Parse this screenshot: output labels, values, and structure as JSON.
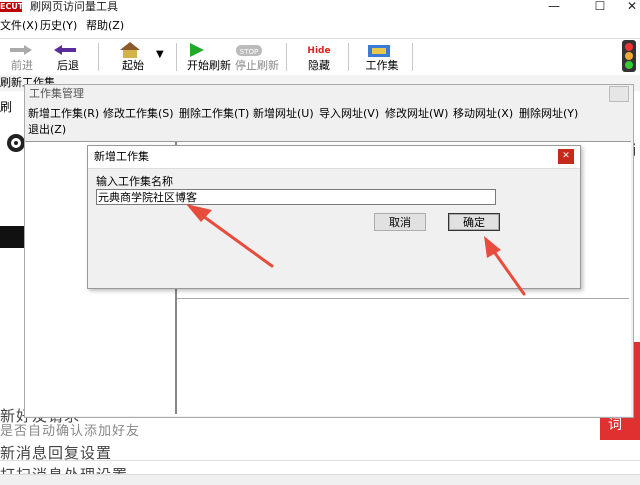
{
  "window": {
    "title": "刷网页访问量工具",
    "icon_text": "ECUT"
  },
  "menubar": [
    "文件(X)",
    "历史(Y)",
    "帮助(Z)"
  ],
  "toolbar": {
    "forward": "前进",
    "back": "后退",
    "start_page": "起始",
    "start_refresh": "开始刷新",
    "stop_refresh": "停止刷新",
    "hide": "隐藏",
    "workset": "工作集",
    "stop_icon_text": "STOP",
    "hide_icon_text": "Hide"
  },
  "background": {
    "toolbar_row_left": "刷新工作集",
    "toolbar_row_left2": "刷",
    "right_text": "销",
    "red_tab_text": "词",
    "rows": [
      "新好友请求",
      "是否自动确认添加好友",
      "新消息回复设置",
      "打扫消息处理设置"
    ]
  },
  "workset_manager": {
    "title": "工作集管理",
    "menu": [
      "新增工作集(R)",
      "修改工作集(S)",
      "删除工作集(T)",
      "新增网址(U)",
      "导入网址(V)",
      "修改网址(W)",
      "移动网址(X)",
      "删除网址(Y)",
      "退出(Z)"
    ]
  },
  "new_workset_dialog": {
    "title": "新增工作集",
    "label": "输入工作集名称",
    "input_value": "元典商学院社区博客",
    "cancel": "取消",
    "ok": "确定"
  },
  "colors": {
    "arrow": "#e84c3d",
    "close_red": "#c42b1c"
  }
}
